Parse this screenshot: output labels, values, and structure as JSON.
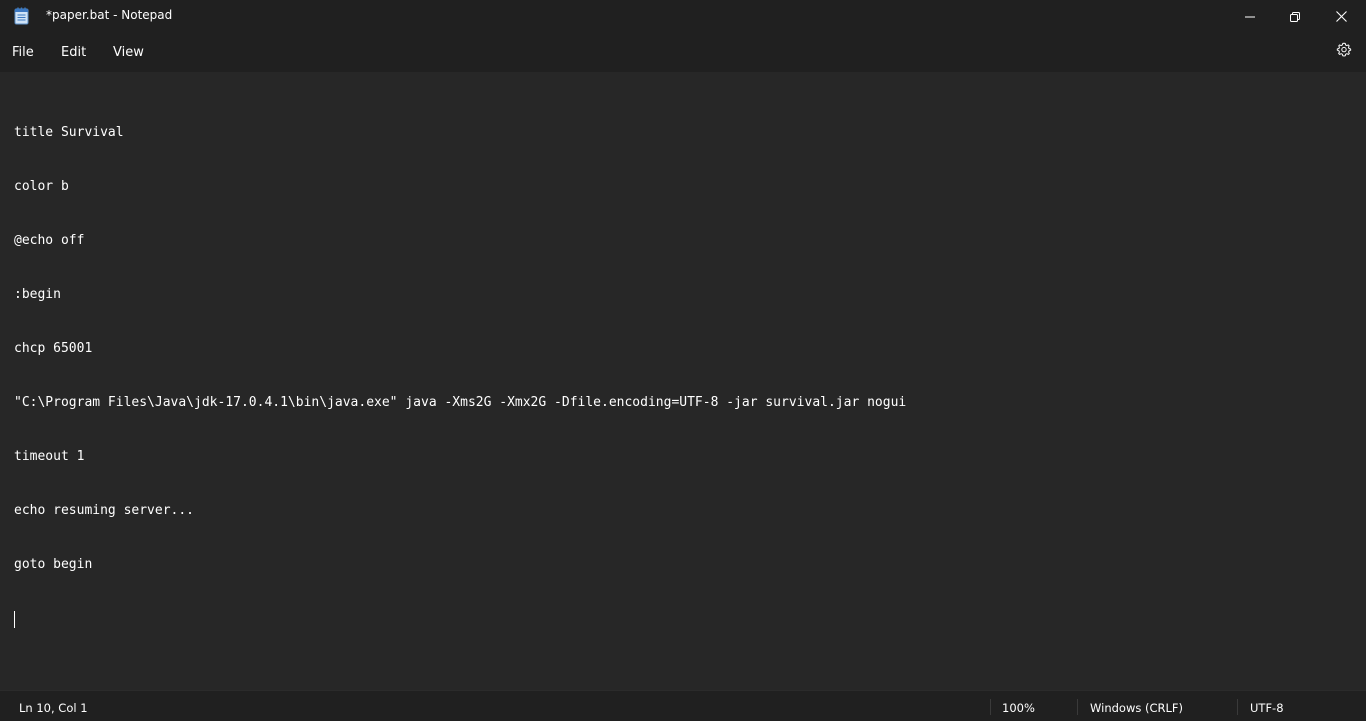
{
  "window": {
    "title": "*paper.bat - Notepad",
    "app_icon": "notepad-icon"
  },
  "menu": {
    "file": "File",
    "edit": "Edit",
    "view": "View"
  },
  "editor": {
    "lines": [
      "title Survival",
      "color b",
      "@echo off",
      ":begin",
      "chcp 65001",
      "\"C:\\Program Files\\Java\\jdk-17.0.4.1\\bin\\java.exe\" java -Xms2G -Xmx2G -Dfile.encoding=UTF-8 -jar survival.jar nogui",
      "timeout 1",
      "echo resuming server...",
      "goto begin",
      ""
    ]
  },
  "status": {
    "position": "Ln 10, Col 1",
    "zoom": "100%",
    "line_endings": "Windows (CRLF)",
    "encoding": "UTF-8"
  },
  "colors": {
    "background": "#272727",
    "chrome": "#202020",
    "text": "#ffffff"
  }
}
